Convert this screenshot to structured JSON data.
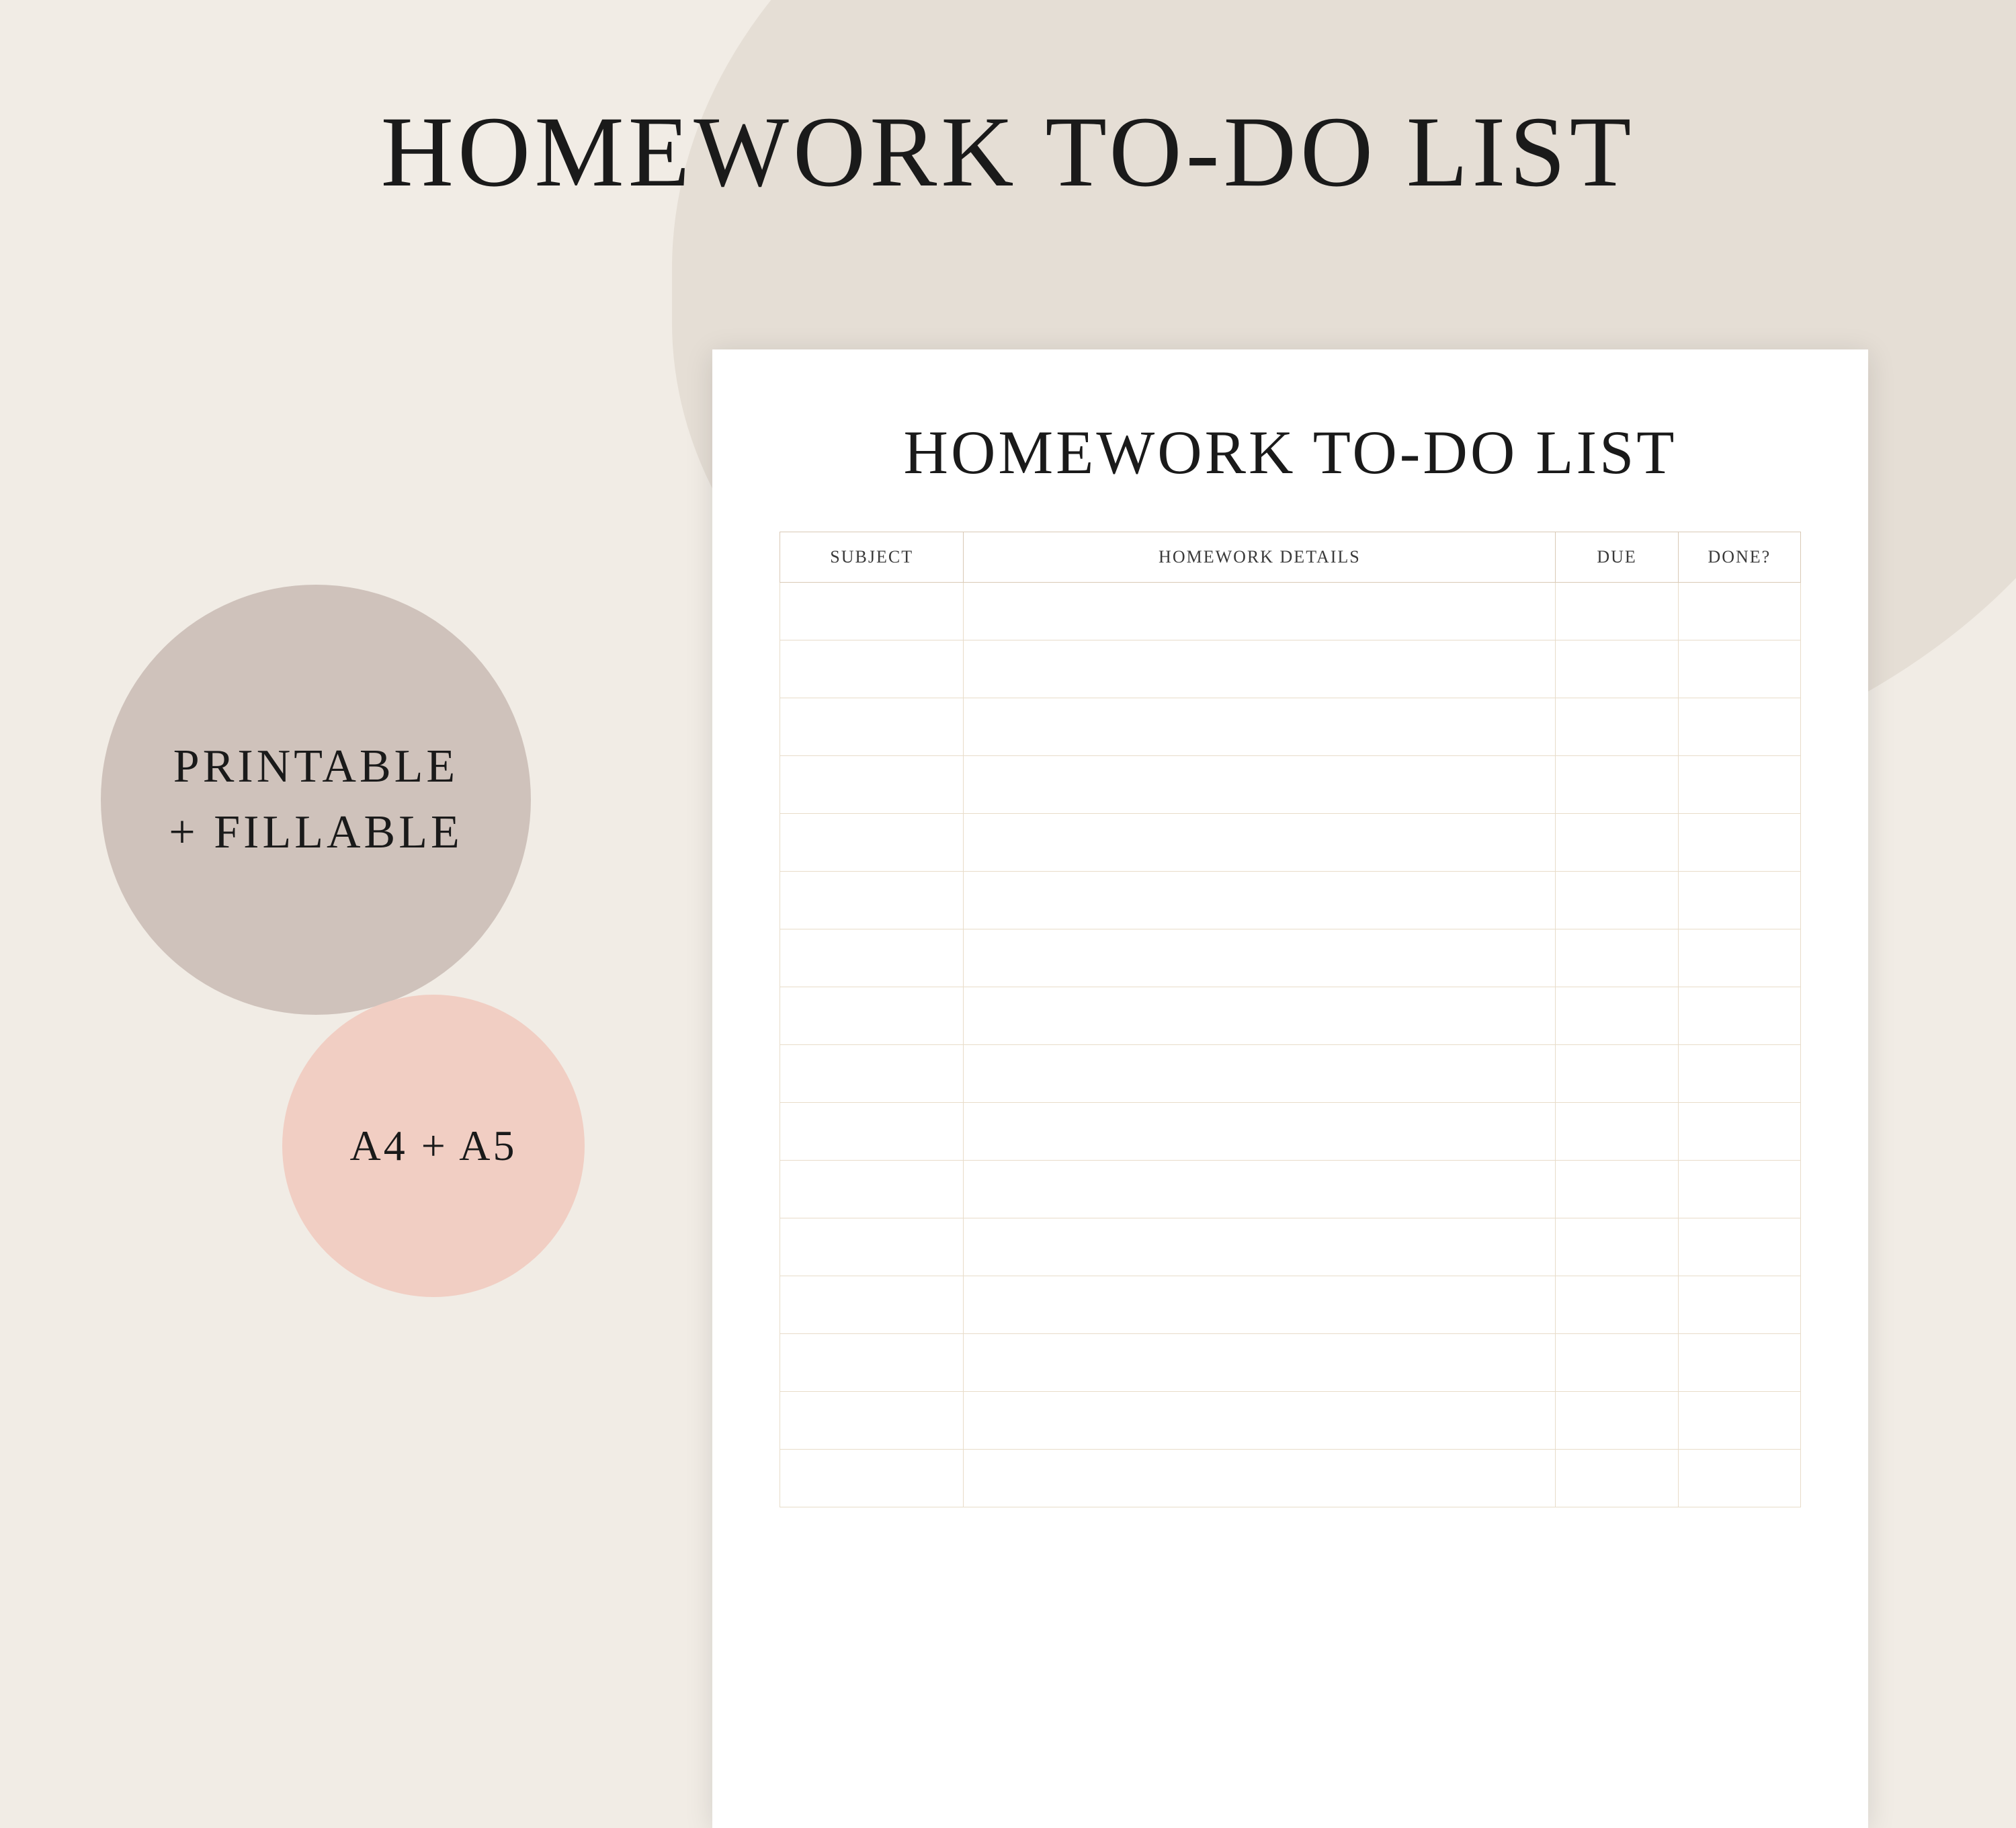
{
  "page": {
    "main_title": "HOMEWORK TO-DO LIST"
  },
  "badges": {
    "large_line1": "PRINTABLE",
    "large_line2": "+ FILLABLE",
    "small": "A4 + A5"
  },
  "paper": {
    "title": "HOMEWORK TO-DO LIST",
    "columns": {
      "subject": "SUBJECT",
      "details": "HOMEWORK DETAILS",
      "due": "DUE",
      "done": "DONE?"
    },
    "row_count": 16
  }
}
